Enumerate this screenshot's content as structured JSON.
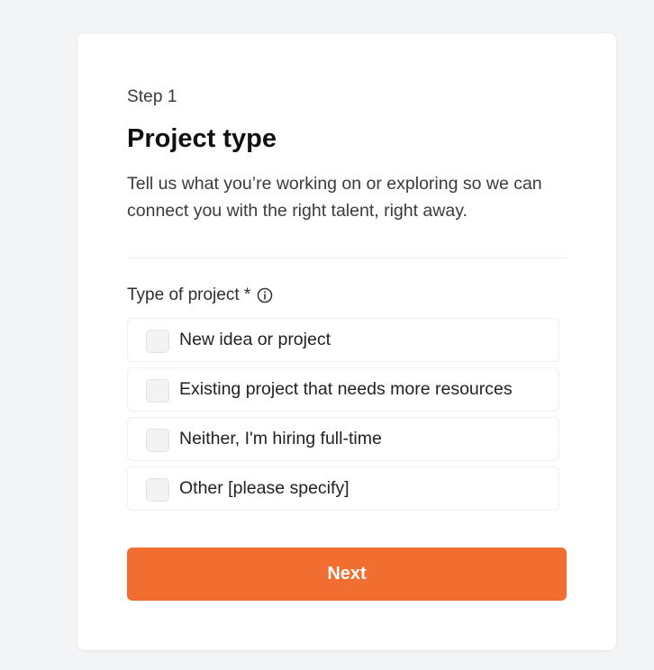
{
  "form": {
    "step_label": "Step 1",
    "title": "Project type",
    "description": "Tell us what you’re working on or exploring so we can connect you with the right talent, right away.",
    "field_label": "Type of project *",
    "info_icon": "info-circle-icon",
    "options": [
      {
        "label": "New idea or project",
        "checked": false
      },
      {
        "label": "Existing project that needs more resources",
        "checked": false
      },
      {
        "label": "Neither, I'm hiring full-time",
        "checked": false
      },
      {
        "label": "Other [please specify]",
        "checked": false
      }
    ],
    "next_label": "Next"
  },
  "colors": {
    "accent": "#f26e30",
    "page_background": "#f3f4f6",
    "card_background": "#ffffff"
  }
}
